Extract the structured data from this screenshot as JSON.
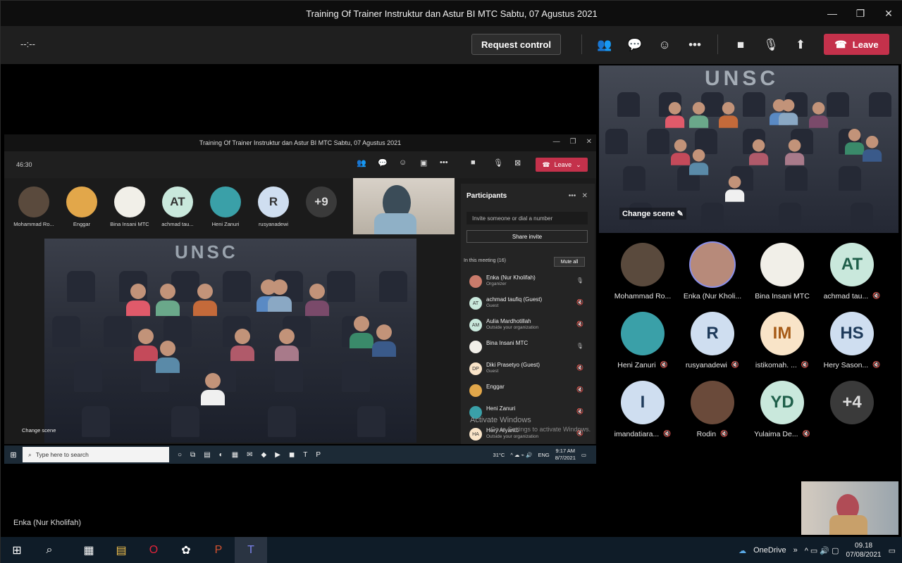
{
  "window": {
    "title": "Training Of Trainer Instruktur dan Astur BI MTC Sabtu, 07 Agustus 2021"
  },
  "meeting_bar": {
    "timer": "--:--",
    "request_control": "Request control",
    "leave": "Leave"
  },
  "shared_screen": {
    "window_title": "Training Of Trainer Instruktur dan Astur BI MTC Sabtu, 07 Agustus 2021",
    "timer": "46:30",
    "leave": "Leave",
    "attendees": [
      {
        "name": "Mohammad Ro...",
        "initials": "",
        "color": "#5a4a3d"
      },
      {
        "name": "Enggar",
        "initials": "",
        "color": "#e2a74a"
      },
      {
        "name": "Bina Insani MTC",
        "initials": "",
        "color": "#f1efe8"
      },
      {
        "name": "achmad tau...",
        "initials": "AT",
        "color": "#c9e8dc"
      },
      {
        "name": "Heni Zanuri",
        "initials": "",
        "color": "#3aa0a8"
      },
      {
        "name": "rusyanadewi",
        "initials": "R",
        "color": "#cfdef0"
      },
      {
        "name": "",
        "initials": "+9",
        "color": "#3a3a3a"
      }
    ],
    "change_scene": "Change scene",
    "participants": {
      "title": "Participants",
      "invite_placeholder": "Invite someone or dial a number",
      "share_invite": "Share invite",
      "in_meeting": "In this meeting (16)",
      "mute_all": "Mute all",
      "list": [
        {
          "name": "Enka (Nur Kholifah)",
          "sub": "Organizer",
          "initials": "",
          "color": "#c97b6b",
          "mic": "🎙"
        },
        {
          "name": "achmad taufiq (Guest)",
          "sub": "Guest",
          "initials": "AT",
          "color": "#c9e8dc",
          "mic": "🔇"
        },
        {
          "name": "Aulia Mardhotillah",
          "sub": "Outside your organization",
          "initials": "AM",
          "color": "#c9e8dc",
          "mic": "🔇"
        },
        {
          "name": "Bina Insani MTC",
          "sub": "",
          "initials": "",
          "color": "#f1efe8",
          "mic": "🎙"
        },
        {
          "name": "Diki Prasetyo (Guest)",
          "sub": "Guest",
          "initials": "DP",
          "color": "#f9e4c8",
          "mic": "🔇"
        },
        {
          "name": "Enggar",
          "sub": "",
          "initials": "",
          "color": "#e2a74a",
          "mic": "🔇"
        },
        {
          "name": "Heni Zanuri",
          "sub": "",
          "initials": "",
          "color": "#3aa0a8",
          "mic": "🔇"
        },
        {
          "name": "Hery Aryanto",
          "sub": "Outside your organization",
          "initials": "HA",
          "color": "#f9e4c8",
          "mic": "🔇"
        }
      ]
    },
    "watermark": "Activate Windows",
    "watermark_sub": "Go to Settings to activate Windows.",
    "taskbar": {
      "search": "Type here to search",
      "weather": "31°C",
      "lang": "ENG",
      "time": "9:17 AM",
      "date": "8/7/2021"
    },
    "presenter": "Enka (Nur Kholifah)"
  },
  "right_panel": {
    "change_scene": "Change scene",
    "tiles": [
      {
        "name": "Mohammad Ro...",
        "initials": "",
        "color": "#5a4a3d",
        "muted": false
      },
      {
        "name": "Enka (Nur Kholi...",
        "initials": "",
        "color": "#b78a7a",
        "muted": false
      },
      {
        "name": "Bina Insani MTC",
        "initials": "",
        "color": "#f1efe8",
        "muted": false
      },
      {
        "name": "achmad tau...",
        "initials": "AT",
        "color": "#c9e8dc",
        "muted": true
      },
      {
        "name": "Heni Zanuri",
        "initials": "",
        "color": "#3aa0a8",
        "muted": true
      },
      {
        "name": "rusyanadewi",
        "initials": "R",
        "color": "#cfdef0",
        "muted": true
      },
      {
        "name": "istikomah. ...",
        "initials": "IM",
        "color": "#f9e4c8",
        "muted": true
      },
      {
        "name": "Hery Sason...",
        "initials": "HS",
        "color": "#cfdef0",
        "muted": true
      },
      {
        "name": "imandatiara...",
        "initials": "I",
        "color": "#cfdef0",
        "muted": true
      },
      {
        "name": "Rodin",
        "initials": "",
        "color": "#6a4a3a",
        "muted": true
      },
      {
        "name": "Yulaima De...",
        "initials": "YD",
        "color": "#c9e8dc",
        "muted": true
      },
      {
        "name": "",
        "initials": "+4",
        "color": "#3a3a3a",
        "muted": false
      }
    ]
  },
  "taskbar": {
    "onedrive": "OneDrive",
    "time": "09.18",
    "date": "07/08/2021"
  }
}
